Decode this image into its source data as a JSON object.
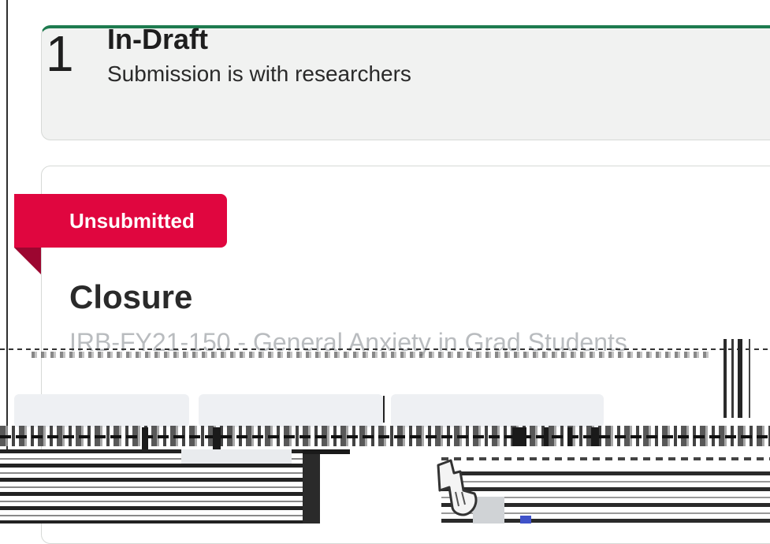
{
  "status_card": {
    "count": "1",
    "label": "In-Draft",
    "description": "Submission is with researchers",
    "accent_color": "#1e7b4f"
  },
  "submission": {
    "badge_label": "Unsubmitted",
    "badge_color": "#e0063f",
    "title": "Closure",
    "protocol_text": "IRB-FY21-150 - General Anxiety in Grad Students"
  },
  "icons": {
    "cursor": "hand-pointer-icon"
  }
}
